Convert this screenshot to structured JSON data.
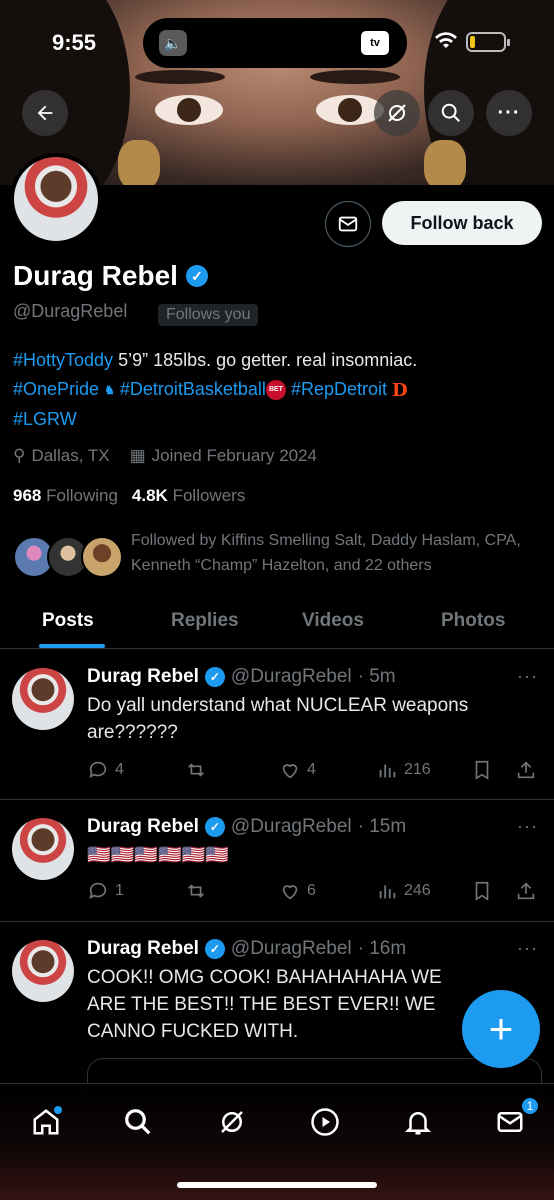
{
  "status_bar": {
    "time": "9:55",
    "tv_label": "tv",
    "battery_level": 0.15
  },
  "profile": {
    "name": "Durag Rebel",
    "handle": "@DuragRebel",
    "follows_you": "Follows you",
    "follow_back_label": "Follow back",
    "bio": {
      "line1_tag": "#HottyToddy",
      "line1_text": " 5’9” 185lbs. go getter. real insomniac.",
      "tag2": "#OnePride",
      "tag3": "#DetroitBasketball",
      "tag4": "#RepDetroit",
      "tag5": "#LGRW"
    },
    "location": "Dallas, TX",
    "joined": "Joined February 2024",
    "following_count": "968",
    "following_label": "Following",
    "followers_count": "4.8K",
    "followers_label": "Followers",
    "followed_by": "Followed by Kiffins Smelling Salt, Daddy Haslam, CPA, Kenneth “Champ” Hazelton, and 22 others"
  },
  "tabs": [
    "Posts",
    "Replies",
    "Videos",
    "Photos"
  ],
  "posts": [
    {
      "name": "Durag Rebel",
      "handle": "@DuragRebel",
      "time": "· 5m",
      "text": "Do yall understand what NUCLEAR weapons are??????",
      "replies": "4",
      "likes": "4",
      "views": "216"
    },
    {
      "name": "Durag Rebel",
      "handle": "@DuragRebel",
      "time": "· 15m",
      "text": "🇺🇸🇺🇸🇺🇸🇺🇸🇺🇸🇺🇸",
      "replies": "1",
      "likes": "6",
      "views": "246"
    },
    {
      "name": "Durag Rebel",
      "handle": "@DuragRebel",
      "time": "· 16m",
      "text": "COOK!! OMG COOK! BAHAHAHAHA WE ARE THE BEST!! THE BEST EVER!! WE CANNO  FUCKED WITH."
    }
  ],
  "nav": {
    "messages_badge": "1"
  },
  "colors": {
    "accent": "#1d9bf0",
    "muted": "#71767b"
  }
}
